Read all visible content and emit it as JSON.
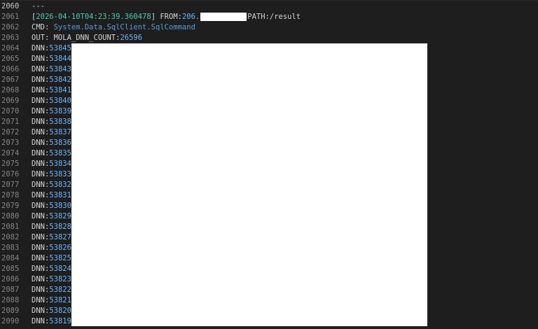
{
  "editor": {
    "lines": [
      {
        "num": "2060",
        "kind": "sep",
        "text": "---"
      },
      {
        "num": "2061",
        "kind": "request",
        "bracket_open": "[",
        "timestamp": "2026-04-10T04:23:39.360478",
        "bracket_close": "]",
        "from_label": " FROM:",
        "from_ip": "206.",
        "path_label": "PATH:/result"
      },
      {
        "num": "2062",
        "kind": "cmd",
        "label": "CMD: ",
        "value": "System.Data.SqlClient.SqlCommand"
      },
      {
        "num": "2063",
        "kind": "out",
        "label": "OUT: MOLA_DNN_COUNT:",
        "value": "26596"
      },
      {
        "num": "2064",
        "kind": "dnn",
        "label": "DNN:",
        "value": "53845"
      },
      {
        "num": "2065",
        "kind": "dnn",
        "label": "DNN:",
        "value": "53844"
      },
      {
        "num": "2066",
        "kind": "dnn",
        "label": "DNN:",
        "value": "53843"
      },
      {
        "num": "2067",
        "kind": "dnn",
        "label": "DNN:",
        "value": "53842"
      },
      {
        "num": "2068",
        "kind": "dnn",
        "label": "DNN:",
        "value": "53841"
      },
      {
        "num": "2069",
        "kind": "dnn",
        "label": "DNN:",
        "value": "53840"
      },
      {
        "num": "2070",
        "kind": "dnn",
        "label": "DNN:",
        "value": "53839"
      },
      {
        "num": "2071",
        "kind": "dnn",
        "label": "DNN:",
        "value": "53838"
      },
      {
        "num": "2072",
        "kind": "dnn",
        "label": "DNN:",
        "value": "53837"
      },
      {
        "num": "2073",
        "kind": "dnn",
        "label": "DNN:",
        "value": "53836"
      },
      {
        "num": "2074",
        "kind": "dnn",
        "label": "DNN:",
        "value": "53835"
      },
      {
        "num": "2075",
        "kind": "dnn",
        "label": "DNN:",
        "value": "53834"
      },
      {
        "num": "2076",
        "kind": "dnn",
        "label": "DNN:",
        "value": "53833"
      },
      {
        "num": "2077",
        "kind": "dnn",
        "label": "DNN:",
        "value": "53832"
      },
      {
        "num": "2078",
        "kind": "dnn",
        "label": "DNN:",
        "value": "53831"
      },
      {
        "num": "2079",
        "kind": "dnn",
        "label": "DNN:",
        "value": "53830"
      },
      {
        "num": "2080",
        "kind": "dnn",
        "label": "DNN:",
        "value": "53829"
      },
      {
        "num": "2081",
        "kind": "dnn",
        "label": "DNN:",
        "value": "53828"
      },
      {
        "num": "2082",
        "kind": "dnn",
        "label": "DNN:",
        "value": "53827"
      },
      {
        "num": "2083",
        "kind": "dnn",
        "label": "DNN:",
        "value": "53826"
      },
      {
        "num": "2084",
        "kind": "dnn",
        "label": "DNN:",
        "value": "53825"
      },
      {
        "num": "2085",
        "kind": "dnn",
        "label": "DNN:",
        "value": "53824"
      },
      {
        "num": "2086",
        "kind": "dnn",
        "label": "DNN:",
        "value": "53823"
      },
      {
        "num": "2087",
        "kind": "dnn",
        "label": "DNN:",
        "value": "53822"
      },
      {
        "num": "2088",
        "kind": "dnn",
        "label": "DNN:",
        "value": "53821"
      },
      {
        "num": "2089",
        "kind": "dnn",
        "label": "DNN:",
        "value": "53820"
      },
      {
        "num": "2090",
        "kind": "dnn",
        "label": "DNN:",
        "value": "53819"
      }
    ]
  },
  "colors": {
    "background": "#1e1e1e",
    "gutter": "#858585",
    "text": "#d4d4d4",
    "number": "#6cb6ff",
    "timestamp": "#4ec9b0",
    "command": "#569cd6",
    "redaction": "#ffffff"
  }
}
